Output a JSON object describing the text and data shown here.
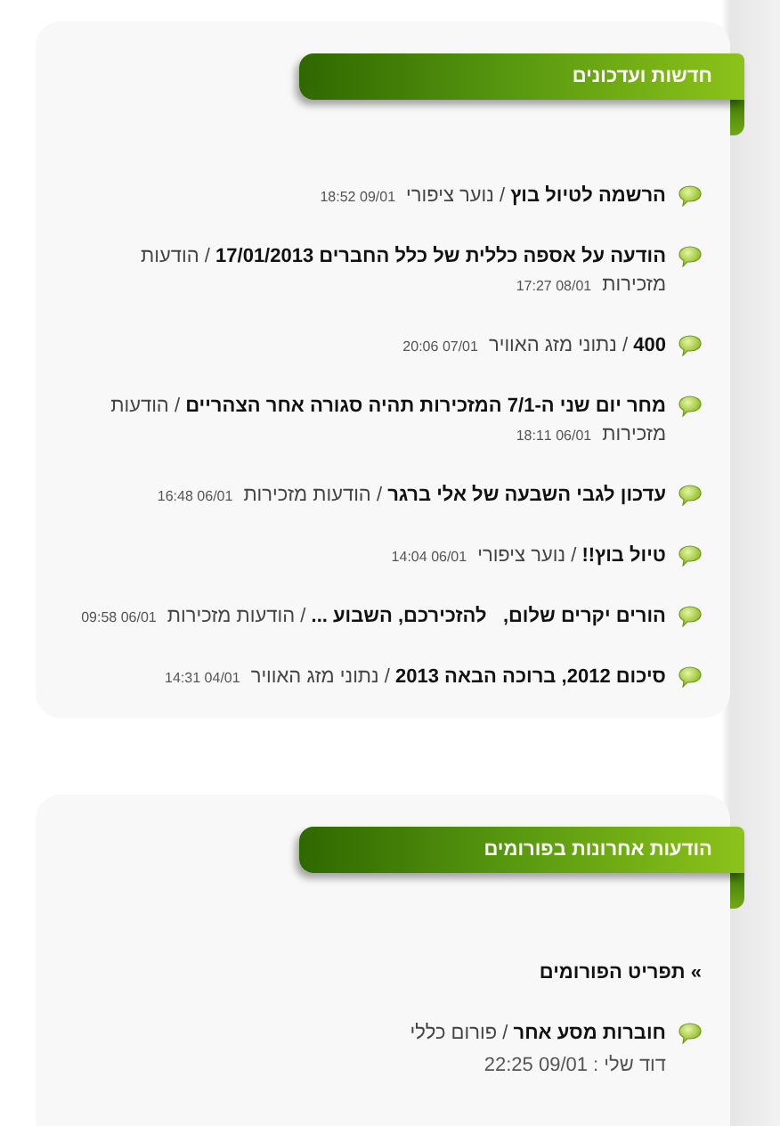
{
  "news": {
    "title": "חדשות ועדכונים",
    "items": [
      {
        "title": "הרשמה לטיול בוץ",
        "separator": "/",
        "category": "נוער ציפורי",
        "date": "09/01 18:52"
      },
      {
        "title": "הודעה על אספה כללית של כלל החברים 17/01/2013",
        "separator": "/",
        "category": "הודעות מזכירות",
        "date": "08/01 17:27"
      },
      {
        "title": "400",
        "separator": "/",
        "category": "נתוני מזג האוויר",
        "date": "07/01 20:06"
      },
      {
        "title": "מחר יום שני ה-7/1 המזכירות תהיה סגורה אחר הצהריים",
        "separator": "/",
        "category": "הודעות מזכירות",
        "date": "06/01 18:11"
      },
      {
        "title": "עדכון לגבי השבעה של אלי ברגר",
        "separator": "/",
        "category": "הודעות מזכירות",
        "date": "06/01 16:48"
      },
      {
        "title": "טיול בוץ!!",
        "separator": "/",
        "category": "נוער ציפורי",
        "date": "06/01 14:04"
      },
      {
        "title": "הורים יקרים שלום,   להזכירכם, השבוע ...",
        "separator": "/",
        "category": "הודעות מזכירות",
        "date": "06/01 09:58"
      },
      {
        "title": "סיכום 2012, ברוכה הבאה 2013",
        "separator": "/",
        "category": "נתוני מזג האוויר",
        "date": "04/01 14:31"
      }
    ]
  },
  "forums": {
    "title": "הודעות אחרונות בפורומים",
    "menu_link": "תפריט הפורומים",
    "menu_marker": "»",
    "items": [
      {
        "title": "חוברות מסע אחר",
        "separator": "/",
        "category": "פורום כללי",
        "byline": "דוד שלי : 09/01 22:25"
      }
    ]
  }
}
